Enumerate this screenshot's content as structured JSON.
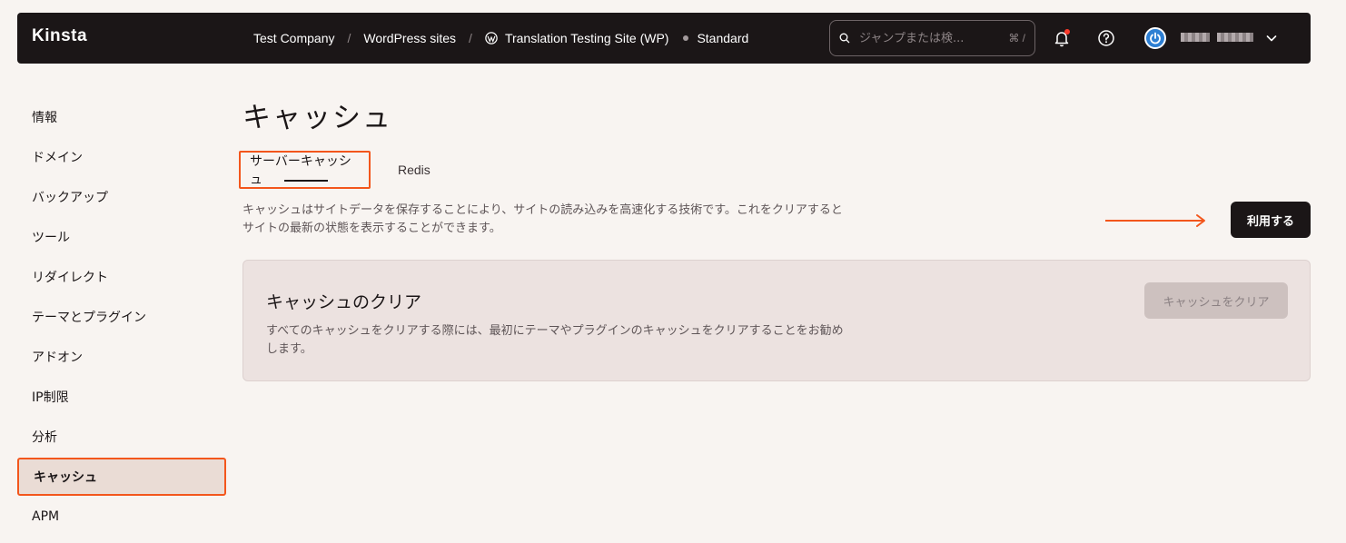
{
  "header": {
    "logo": "Kinsta",
    "breadcrumbs": [
      "Test Company",
      "WordPress sites",
      "Translation Testing Site (WP)"
    ],
    "separator": "/",
    "environment": "Standard",
    "search": {
      "placeholder": "ジャンプまたは検...",
      "shortcut": "⌘ /"
    },
    "icons": [
      "search-icon",
      "bell-icon",
      "help-icon",
      "wordpress-icon",
      "power-icon",
      "chevron-down-icon"
    ],
    "notification_color": "#ff3a2b"
  },
  "sidebar": {
    "items": [
      {
        "label": "情報"
      },
      {
        "label": "ドメイン"
      },
      {
        "label": "バックアップ"
      },
      {
        "label": "ツール"
      },
      {
        "label": "リダイレクト"
      },
      {
        "label": "テーマとプラグイン"
      },
      {
        "label": "アドオン"
      },
      {
        "label": "IP制限"
      },
      {
        "label": "分析"
      },
      {
        "label": "キャッシュ",
        "active": true
      },
      {
        "label": "APM"
      }
    ]
  },
  "main": {
    "title": "キャッシュ",
    "tabs": [
      {
        "label": "サーバーキャッシュ",
        "active": true
      },
      {
        "label": "Redis",
        "active": false
      }
    ],
    "description": "キャッシュはサイトデータを保存することにより、サイトの読み込みを高速化する技術です。これをクリアするとサイトの最新の状態を表示することができます。",
    "use_button": "利用する",
    "card": {
      "title": "キャッシュのクリア",
      "description": "すべてのキャッシュをクリアする際には、最初にテーマやプラグインのキャッシュをクリアすることをお勧めします。",
      "button": "キャッシュをクリア"
    }
  },
  "colors": {
    "topbar": "#1b1617",
    "background": "#f8f4f1",
    "highlight": "#f3561c",
    "card": "#ece2e0",
    "disabled_button": "#cdc1bf"
  }
}
